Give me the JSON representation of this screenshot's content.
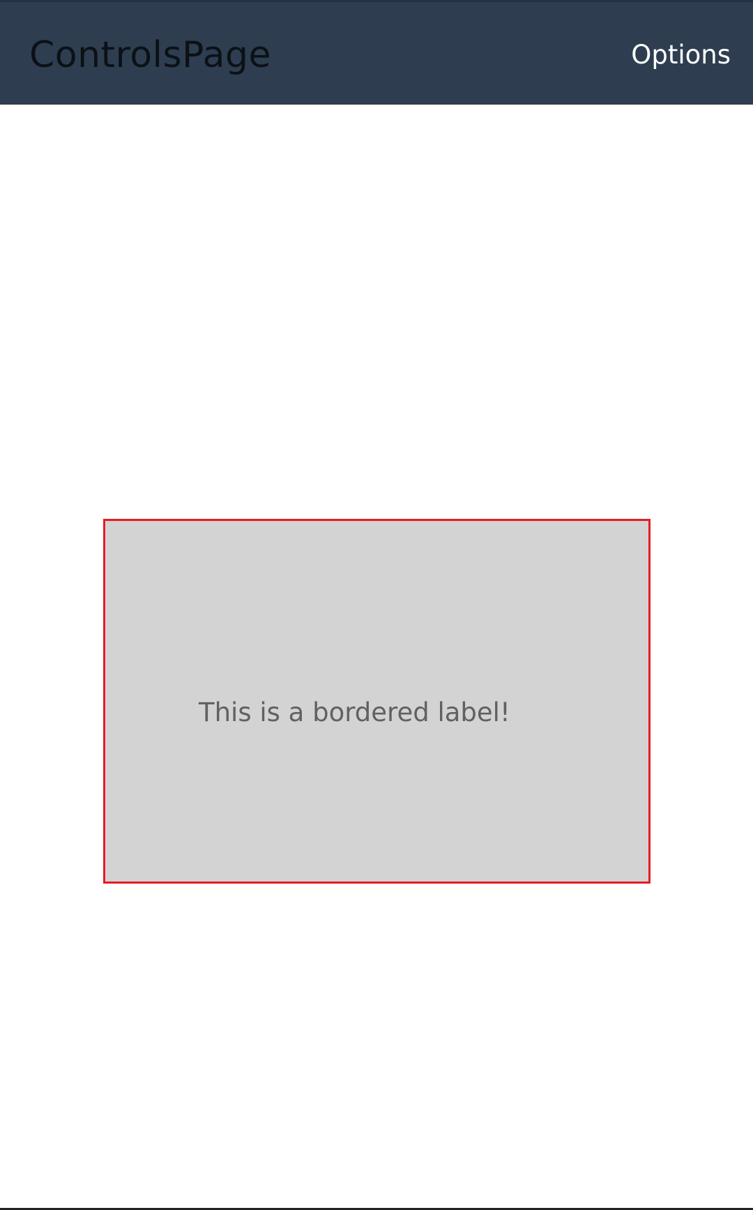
{
  "app_bar": {
    "title": "ControlsPage",
    "options_label": "Options",
    "background_color": "#2e3e50"
  },
  "main": {
    "bordered_label": {
      "text": "This is a bordered label!",
      "border_color": "#e61c23",
      "background_color": "#d3d3d3"
    }
  }
}
